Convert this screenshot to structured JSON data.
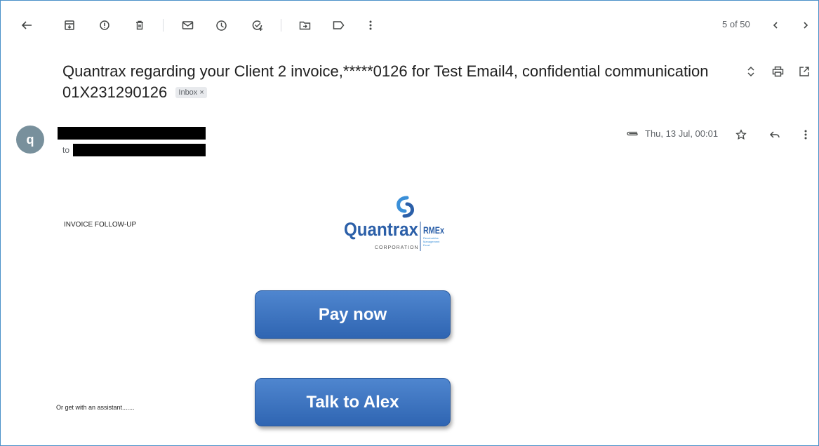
{
  "toolbar": {
    "page_counter": "5 of 50"
  },
  "subject": {
    "title": "Quantrax regarding your Client 2 invoice,*****0126 for Test Email4, confidential communication 01X231290126",
    "label_chip": "Inbox ×"
  },
  "message": {
    "avatar_letter": "q",
    "to_label": "to",
    "date": "Thu, 13 Jul, 00:01"
  },
  "body": {
    "heading": "INVOICE FOLLOW-UP",
    "assistant_text": "Or get with an assistant.......",
    "pay_button": "Pay now",
    "talk_button": "Talk to Alex",
    "logo": {
      "wordmark": "Quantrax",
      "corp": "CORPORATION",
      "product": "RMEx",
      "tagline": "Receivables Management Excel",
      "brand_color": "#2b5fa8",
      "accent_color": "#3a8fd8"
    }
  },
  "colors": {
    "button": "#3a6fc0",
    "frame": "#4a90c8"
  }
}
